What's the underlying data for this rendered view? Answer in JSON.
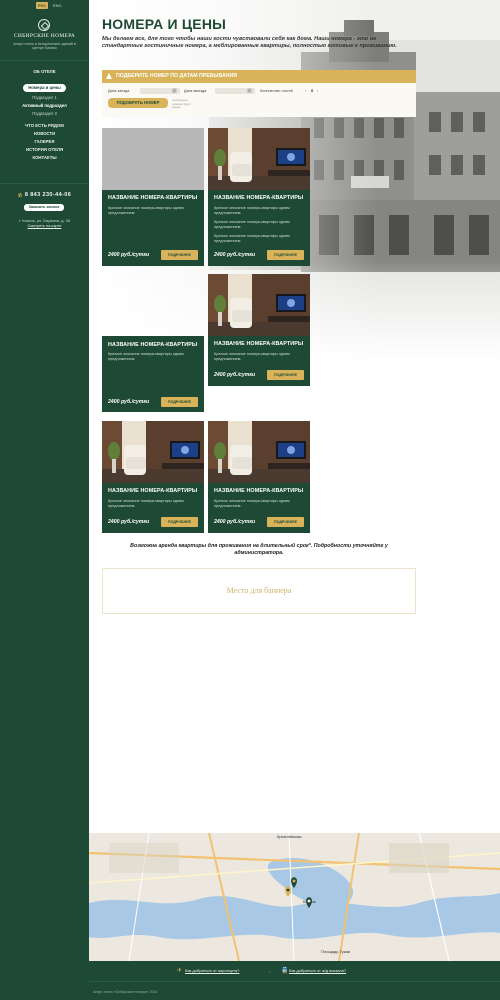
{
  "sidebar": {
    "lang": {
      "active": "РУС",
      "other": "ENG"
    },
    "logo_text": "СИБИРСКИЕ НОМЕРА",
    "logo_sub": "Апарт-отель и исторических зданий в центре Казани",
    "nav": [
      {
        "label": "Об отеле",
        "kind": "item"
      },
      {
        "label": "Номера и цены",
        "kind": "pill"
      },
      {
        "label": "Подраздел 1",
        "kind": "sub"
      },
      {
        "label": "Активный подраздел",
        "kind": "sub-active"
      },
      {
        "label": "Подраздел 3",
        "kind": "sub"
      },
      {
        "label": "Что есть рядом",
        "kind": "item"
      },
      {
        "label": "Новости",
        "kind": "item"
      },
      {
        "label": "Галерея",
        "kind": "item"
      },
      {
        "label": "История отеля",
        "kind": "item"
      },
      {
        "label": "Контакты",
        "kind": "item"
      }
    ],
    "phone": "8 843 230-44-06",
    "callback_label": "Заказать звонок",
    "address": "г. Казань, ул. Баумана, д. 38",
    "map_link": "Смотреть на карте"
  },
  "main": {
    "title": "НОМЕРА И ЦЕНЫ",
    "intro": "Мы делаем все, для того чтобы наши гости чувствовали себя как дома. Наши номера - это не стандартные гостиничные номера, а меблированные квартиры, полностью готовые к проживанию.",
    "filter": {
      "header": "ПОДБЕРИТЕ НОМЕР ПО ДАТАМ ПРЕБЫВАНИЯ",
      "checkin_label": "Дата заезда",
      "checkout_label": "Дата выезда",
      "guests_label": "Количество гостей",
      "guests_value": "0",
      "button_label": "ПОДОБРАТЬ НОМЕР",
      "note": "Свободные номера будут видны"
    },
    "cards": [
      {
        "title": "НАЗВАНИЕ НОМЕРА-КВАРТИРЫ",
        "desc": [
          "Краткое описание номера-квартиры одним предложением."
        ],
        "price": "2400 руб./сутки",
        "book": "ПОДРОБНЕЕ",
        "photo": false
      },
      {
        "title": "НАЗВАНИЕ НОМЕРА-КВАРТИРЫ",
        "desc": [
          "Краткое описание номера-квартиры одним предложением.",
          "Краткое описание номера-квартиры одним предложением.",
          "Краткое описание номера-квартиры одним предложением."
        ],
        "price": "2400 руб./сутки",
        "book": "ПОДРОБНЕЕ",
        "photo": true
      },
      {
        "title": "НАЗВАНИЕ НОМЕРА-КВАРТИРЫ",
        "desc": [
          "Краткое описание номера-квартиры одним предложением."
        ],
        "price": "2400 руб./сутки",
        "book": "ПОДРОБНЕЕ",
        "photo": false
      },
      {
        "title": "НАЗВАНИЕ НОМЕРА-КВАРТИРЫ",
        "desc": [
          "Краткое описание номера-квартиры одним предложением."
        ],
        "price": "2400 руб./сутки",
        "book": "ПОДРОБНЕЕ",
        "photo": true
      },
      {
        "title": "НАЗВАНИЕ НОМЕРА-КВАРТИРЫ",
        "desc": [
          "Краткое описание номера-квартиры одним предложением."
        ],
        "price": "2400 руб./сутки",
        "book": "ПОДРОБНЕЕ",
        "photo": true
      },
      {
        "title": "НАЗВАНИЕ НОМЕРА-КВАРТИРЫ",
        "desc": [
          "Краткое описание номера-квартиры одним предложением."
        ],
        "price": "2400 руб./сутки",
        "book": "ПОДРОБНЕЕ",
        "photo": true
      }
    ],
    "long_term": "Возможна аренда квартиры для проживания на длительный срок*. Подробности уточняйте у администратора.",
    "banner": "Место для баннера"
  },
  "map": {
    "labels": [
      "Казань",
      "Кремлёвская",
      "Площадь Тукая"
    ]
  },
  "map_bar": {
    "airport": "Как добраться от аэропорта?",
    "station": "Как добраться от ж/д вокзала?"
  },
  "footer": {
    "copyright": "Апарт-отель «Сибирские номера» 2014"
  },
  "colors": {
    "brand_green": "#1e4a35",
    "accent_gold": "#d9b35a"
  }
}
